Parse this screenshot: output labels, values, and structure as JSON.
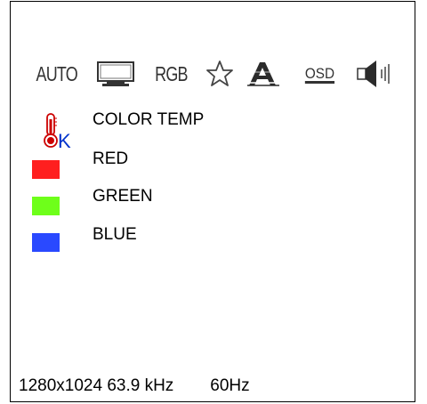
{
  "toolbar": {
    "auto_label": "AUTO",
    "rgb_label": "RGB",
    "osd_label": "OSD",
    "icons": [
      "monitor-icon",
      "star-icon",
      "font-icon",
      "speaker-icon"
    ]
  },
  "menu": {
    "items": [
      {
        "label": "COLOR TEMP",
        "icon": "thermometer-icon",
        "icon_text": "K"
      },
      {
        "label": "RED",
        "swatch": "#ff1f1f"
      },
      {
        "label": "GREEN",
        "swatch": "#6eff1a"
      },
      {
        "label": "BLUE",
        "swatch": "#2a49ff"
      }
    ]
  },
  "status": {
    "resolution": "1280x1024 63.9 kHz",
    "refresh": "60Hz"
  }
}
